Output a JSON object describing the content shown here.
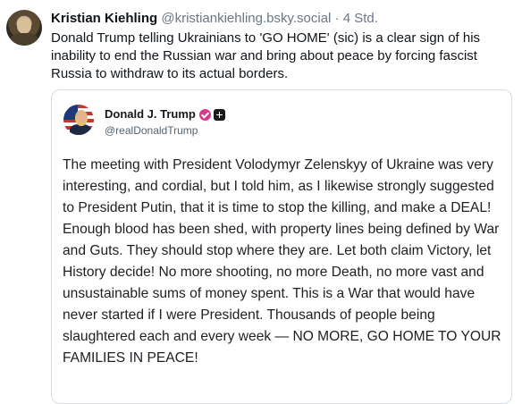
{
  "post": {
    "author_name": "Kristian Kiehling",
    "handle": "@kristiankiehling.bsky.social",
    "separator": "·",
    "timestamp": "4 Std.",
    "text": "Donald Trump telling Ukrainians to 'GO HOME' (sic) is a clear sign of his inability to end the Russian war and bring about peace by forcing fascist Russia to withdraw to its actual borders."
  },
  "quoted_post": {
    "author_name": "Donald J. Trump",
    "handle": "@realDonaldTrump",
    "text": "The meeting with President Volodymyr Zelenskyy of Ukraine was very interesting, and cordial, but I told him, as I likewise strongly suggested to President Putin, that it is time to stop the killing, and make a DEAL! Enough blood has been shed, with property lines being defined by War and Guts. They should stop where they are. Let both claim Victory, let History decide! No more shooting, no more Death, no more vast and unsustainable sums of money spent. This is a War that would have never started if I were President. Thousands of people being slaughtered each and every week — NO MORE, GO HOME TO YOUR FAMILIES IN PEACE!",
    "badges": [
      "verified-icon",
      "plus-icon"
    ],
    "badge_color": "#d63a8f"
  }
}
